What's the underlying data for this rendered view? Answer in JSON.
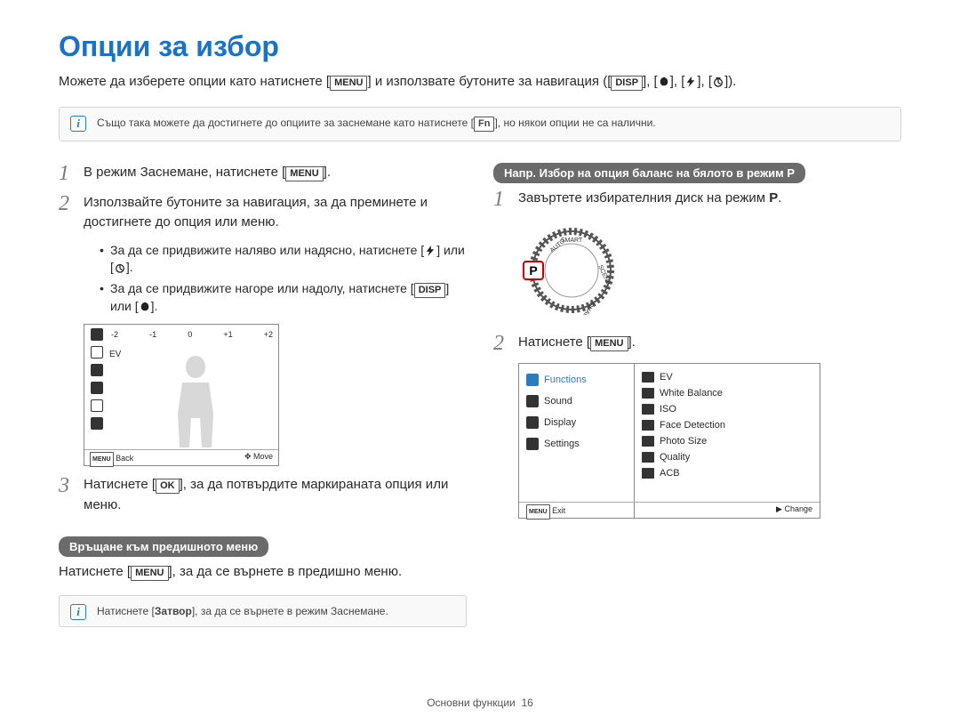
{
  "title": "Опции за избор",
  "subtitle": {
    "pre": "Можете да изберете опции като натиснете [",
    "menu": "MENU",
    "mid": "] и използвате бутоните за навигация ([",
    "disp": "DISP",
    "sep1": "], [",
    "sep2": "], [",
    "sep3": "], [",
    "end": "])."
  },
  "info1": {
    "pre": "Също така можете да достигнете до опциите за заснемане като натиснете [",
    "fn": "Fn",
    "post": "], но някои опции не са налични."
  },
  "left": {
    "step1": {
      "pre": "В режим Заснемане, натиснете [",
      "menu": "MENU",
      "post": "]."
    },
    "step2": "Използвайте бутоните за навигация, за да преминете и достигнете до опция или меню.",
    "bullet1": {
      "pre": "За да се придвижите наляво или надясно, натиснете [",
      "mid": "] или [",
      "post": "]."
    },
    "bullet2": {
      "pre": "За да се придвижите нагоре или надолу, натиснете [",
      "disp": "DISP",
      "mid": "] или [",
      "post": "]."
    },
    "screen": {
      "ev_scale": [
        "-2",
        "-1",
        "0",
        "+1",
        "+2"
      ],
      "ev_label": "EV",
      "back_key": "MENU",
      "back_label": "Back",
      "move_label": "Move"
    },
    "step3": {
      "pre": "Натиснете [",
      "ok": "OK",
      "post": "], за да потвърдите маркираната опция или меню."
    },
    "subhead": "Връщане към предишното меню",
    "return_line": {
      "pre": "Натиснете [",
      "menu": "MENU",
      "post": "], за да се върнете в предишно меню."
    },
    "info2": {
      "pre": "Натиснете [",
      "shutter": "Затвор",
      "post": "], за да се върнете в режим Заснемане."
    }
  },
  "right": {
    "subhead": "Напр. Избор на опция баланс на бялото в режим P",
    "step1": {
      "pre": "Завъртете избирателния диск на режим ",
      "p": "P",
      "post": "."
    },
    "dial_modes": [
      "P",
      "AUTO",
      "SMART",
      "SCENE",
      "DUAL"
    ],
    "step2": {
      "pre": "Натиснете [",
      "menu": "MENU",
      "post": "]."
    },
    "menu": {
      "left_items": [
        {
          "label": "Functions",
          "selected": true
        },
        {
          "label": "Sound",
          "selected": false
        },
        {
          "label": "Display",
          "selected": false
        },
        {
          "label": "Settings",
          "selected": false
        }
      ],
      "right_items": [
        "EV",
        "White Balance",
        "ISO",
        "Face Detection",
        "Photo Size",
        "Quality",
        "ACB"
      ],
      "exit_key": "MENU",
      "exit_label": "Exit",
      "change_label": "Change"
    }
  },
  "footer": {
    "section": "Основни функции",
    "page": "16"
  }
}
